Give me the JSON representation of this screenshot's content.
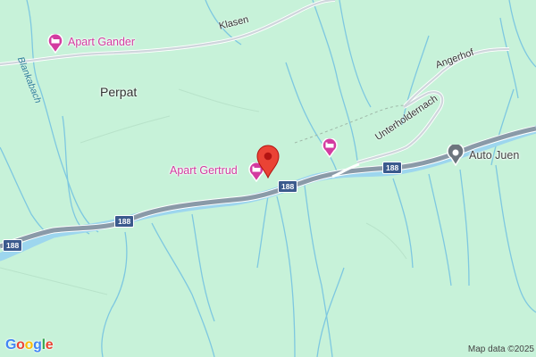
{
  "map": {
    "pois": [
      {
        "name": "Apart Gander",
        "icon": "hotel-icon",
        "color": "#d33ba0"
      },
      {
        "name": "Apart Gertrud",
        "icon": "hotel-icon",
        "color": "#d33ba0"
      },
      {
        "name": "",
        "icon": "hotel-icon",
        "color": "#d33ba0"
      },
      {
        "name": "Auto Juen",
        "icon": "business-icon",
        "color": "#6c757d"
      }
    ],
    "places": [
      "Perpat"
    ],
    "roads": [
      "Klasen",
      "Angerhof",
      "Unterholdernach"
    ],
    "streams": [
      "Blankabach"
    ],
    "route_shields": [
      "188",
      "188",
      "188",
      "188"
    ],
    "marker": {
      "icon": "location-pin-icon",
      "color": "#ea4335"
    },
    "colors": {
      "land": "#c7f2d9",
      "water": "#9dd6ee",
      "highway": "#8a9aa8",
      "poi": "#d33ba0"
    }
  },
  "branding": {
    "logo": "Google",
    "attribution": "Map data ©2025"
  }
}
